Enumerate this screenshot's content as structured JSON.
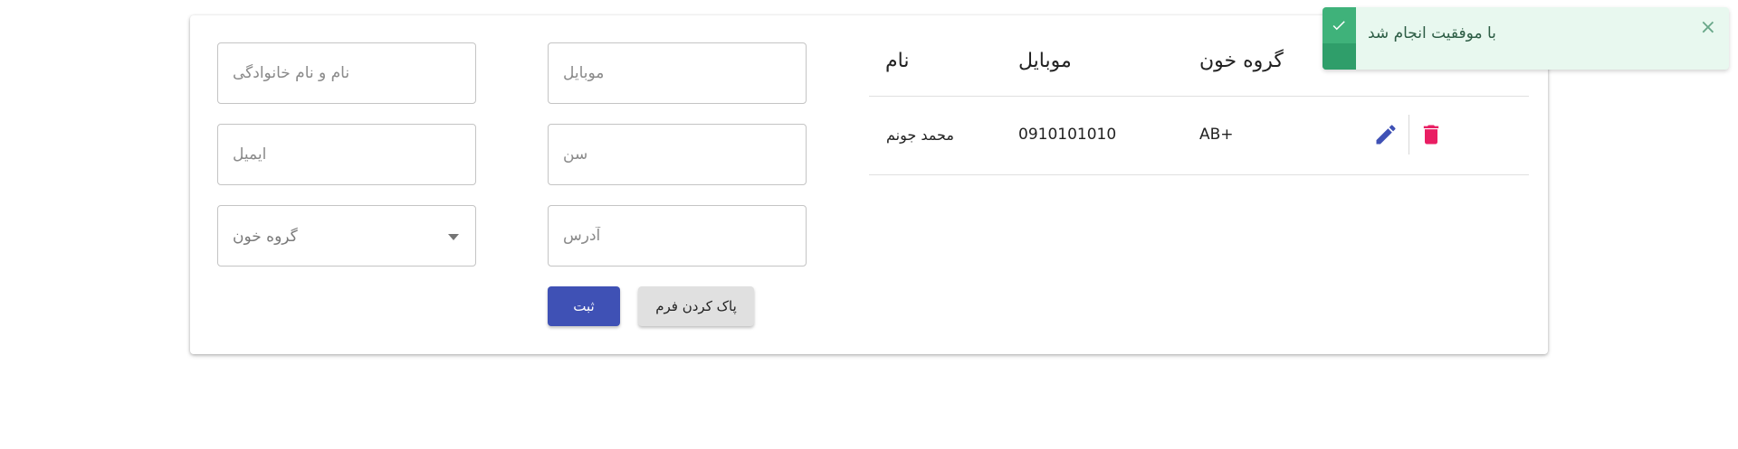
{
  "form": {
    "fullname_placeholder": "نام و نام خانوادگی",
    "mobile_placeholder": "موبایل",
    "email_placeholder": "ایمیل",
    "age_placeholder": "سن",
    "blood_group_placeholder": "گروه خون",
    "address_placeholder": "آدرس",
    "submit_label": "ثبت",
    "clear_label": "پاک کردن فرم"
  },
  "table": {
    "headers": {
      "name": "نام",
      "mobile": "موبایل",
      "blood_group": "گروه خون"
    },
    "rows": [
      {
        "name": "محمد جونم",
        "mobile": "0910101010",
        "blood_group": "AB+"
      }
    ]
  },
  "toast": {
    "message": "با موفقیت انجام شد",
    "close_symbol": "×"
  },
  "colors": {
    "primary": "#3f51b5",
    "delete": "#e91e63",
    "success": "#3fb27a"
  },
  "icons": {
    "edit": "pencil-icon",
    "delete": "trash-icon",
    "success": "check-icon"
  }
}
